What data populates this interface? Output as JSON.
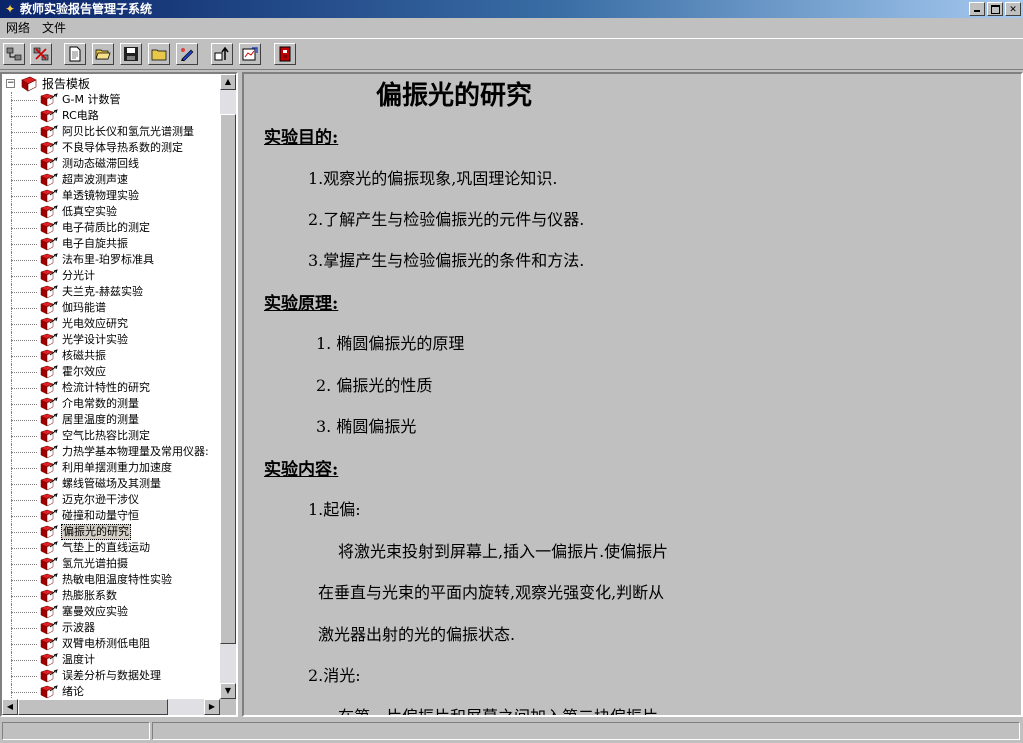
{
  "window": {
    "title": "教师实验报告管理子系统",
    "controls": [
      "minimize",
      "maximize",
      "close"
    ],
    "close_glyph": "✕"
  },
  "menu": {
    "items": [
      "网络",
      "文件"
    ]
  },
  "toolbar": {
    "buttons": [
      "connect-icon",
      "disconnect-icon",
      "new-icon",
      "open-folder-icon",
      "save-icon",
      "folder-icon",
      "edit-pen-icon",
      "upload-icon",
      "chart-edit-icon",
      "exit-icon"
    ]
  },
  "tree": {
    "root_label": "报告模板",
    "expander": "−",
    "items": [
      "G-M 计数管",
      "RC电路",
      "阿贝比长仪和氢氘光谱测量",
      "不良导体导热系数的测定",
      "测动态磁滞回线",
      "超声波测声速",
      "单透镜物理实验",
      "低真空实验",
      "电子荷质比的测定",
      "电子自旋共振",
      "法布里-珀罗标准具",
      "分光计",
      "夫兰克-赫兹实验",
      "伽玛能谱",
      "光电效应研究",
      "光学设计实验",
      "核磁共振",
      "霍尔效应",
      "检流计特性的研究",
      "介电常数的测量",
      "居里温度的测量",
      "空气比热容比测定",
      "力热学基本物理量及常用仪器:",
      "利用单摆测重力加速度",
      "螺线管磁场及其测量",
      "迈克尔逊干涉仪",
      "碰撞和动量守恒",
      "偏振光的研究",
      "气垫上的直线运动",
      "氢氘光谱拍摄",
      "热敏电阻温度特性实验",
      "热膨胀系数",
      "塞曼效应实验",
      "示波器",
      "双臂电桥测低电阻",
      "温度计",
      "误差分析与数据处理",
      "绪论"
    ],
    "selected_index": 27
  },
  "document": {
    "title": "偏振光的研究",
    "sections": [
      {
        "heading": "实验目的:"
      },
      {
        "heading": "实验原理:"
      },
      {
        "heading": "实验内容:"
      }
    ],
    "purpose": [
      "1.观察光的偏振现象,巩固理论知识.",
      "2.了解产生与检验偏振光的元件与仪器.",
      "3.掌握产生与检验偏振光的条件和方法."
    ],
    "principle": [
      "1.  椭圆偏振光的原理",
      "2.  偏振光的性质",
      "3.  椭圆偏振光"
    ],
    "content": {
      "step1_title": "1.起偏:",
      "step1_lines": [
        "将激光束投射到屏幕上,插入一偏振片.使偏振片",
        "在垂直与光束的平面内旋转,观察光强变化,判断从",
        "激光器出射的光的偏振状态."
      ],
      "step2_title": "2.消光:",
      "step2_partial": "在第一片偏振片和屏幕之间加入第二块偏振片"
    }
  },
  "statusbar": {
    "panes": [
      "",
      ""
    ]
  }
}
